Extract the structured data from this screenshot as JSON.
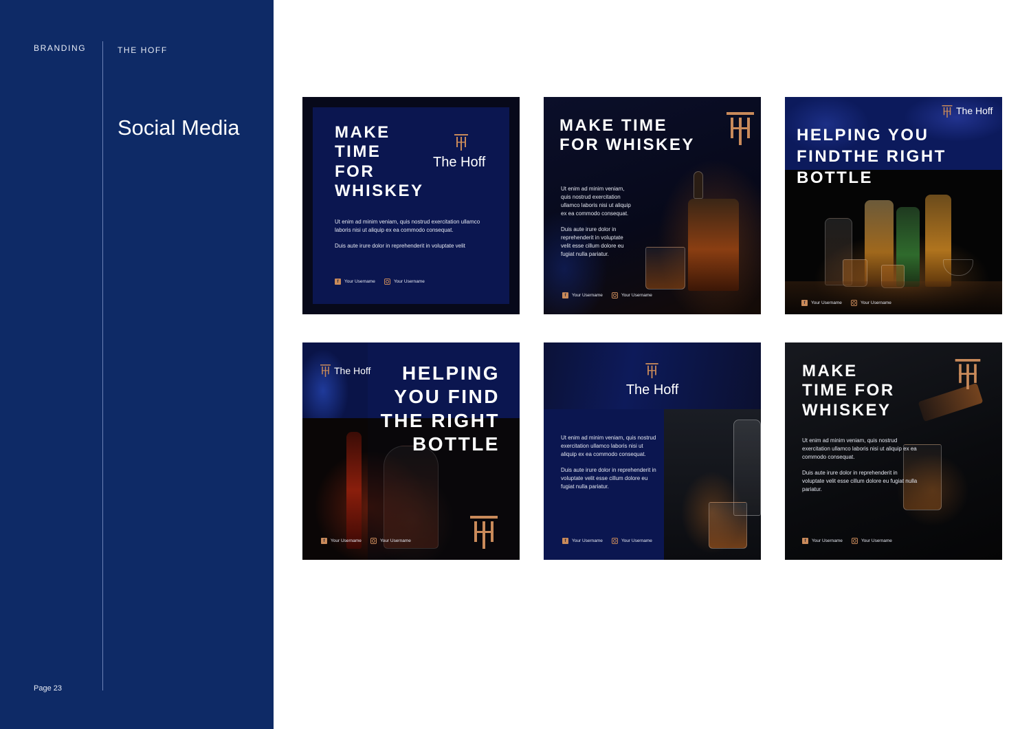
{
  "sidebar": {
    "section_label": "BRANDING",
    "project_name": "THE HOFF",
    "page_title": "Social Media",
    "page_number": "Page 23"
  },
  "colors": {
    "sidebar_bg": "#0e2a66",
    "card_navy": "#0b1650",
    "accent_copper": "#c98a5a",
    "card_dark": "#07091a"
  },
  "cards": [
    {
      "headline": [
        "MAKE",
        "TIME",
        "FOR",
        "WHISKEY"
      ],
      "brand": "The Hoff",
      "body": [
        "Ut enim ad minim veniam, quis nostrud exercitation ullamco laboris nisi ut aliquip ex ea commodo consequat.",
        "Duis aute irure dolor in reprehenderit in voluptate velit"
      ],
      "social": [
        "Your Username",
        "Your Username"
      ]
    },
    {
      "headline": [
        "MAKE TIME",
        "FOR WHISKEY"
      ],
      "body": [
        "Ut enim ad minim veniam, quis nostrud exercitation ullamco laboris nisi ut aliquip ex ea commodo consequat.",
        "Duis aute irure dolor in reprehenderit in voluptate velit esse cillum dolore eu fugiat nulla pariatur."
      ],
      "social": [
        "Your Username",
        "Your Username"
      ]
    },
    {
      "headline": [
        "HELPING YOU",
        "FINDTHE RIGHT",
        "BOTTLE"
      ],
      "brand": "The Hoff",
      "social": [
        "Your Username",
        "Your Username"
      ]
    },
    {
      "headline": [
        "HELPING",
        "YOU FIND",
        "THE RIGHT",
        "BOTTLE"
      ],
      "brand": "The Hoff",
      "social": [
        "Your Username",
        "Your Username"
      ]
    },
    {
      "brand": "The Hoff",
      "body": [
        "Ut enim ad minim veniam, quis nostrud exercitation ullamco laboris nisi ut aliquip ex ea commodo consequat.",
        "Duis aute irure dolor in reprehenderit in voluptate velit esse cillum dolore eu fugiat nulla pariatur."
      ],
      "social": [
        "Your Username",
        "Your Username"
      ]
    },
    {
      "headline": [
        "MAKE",
        "TIME FOR",
        "WHISKEY"
      ],
      "body": [
        "Ut enim ad minim veniam, quis nostrud exercitation ullamco laboris nisi ut aliquip ex ea commodo consequat.",
        "Duis aute irure dolor in reprehenderit in voluptate velit esse cillum dolore eu fugiat nulla pariatur."
      ],
      "social": [
        "Your Username",
        "Your Username"
      ]
    }
  ],
  "icons": {
    "logo": "th-monogram-icon",
    "facebook": "facebook-icon",
    "instagram": "instagram-icon"
  }
}
